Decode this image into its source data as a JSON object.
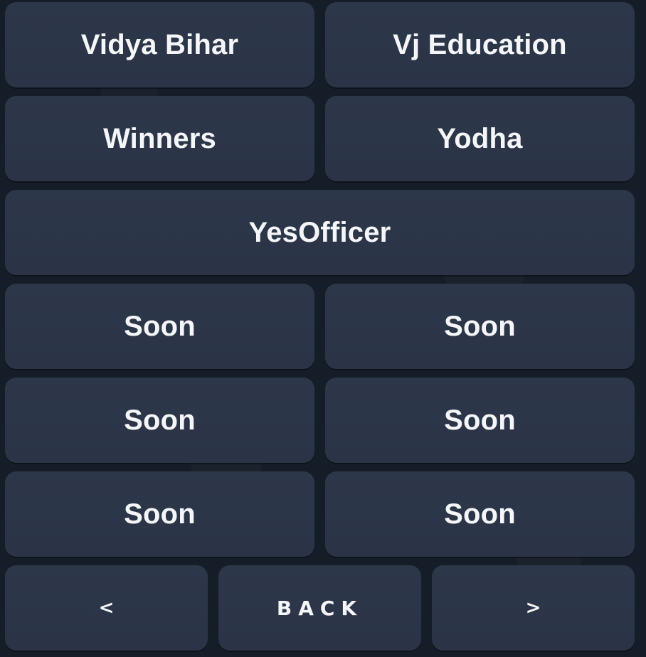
{
  "keyboard": {
    "rows": [
      [
        "Vidya Bihar",
        "Vj Education"
      ],
      [
        "Winners",
        "Yodha"
      ],
      [
        "YesOfficer"
      ],
      [
        "Soon",
        "Soon"
      ],
      [
        "Soon",
        "Soon"
      ],
      [
        "Soon",
        "Soon"
      ]
    ],
    "nav": {
      "prev": "<",
      "back": "BACK",
      "next": ">"
    }
  }
}
